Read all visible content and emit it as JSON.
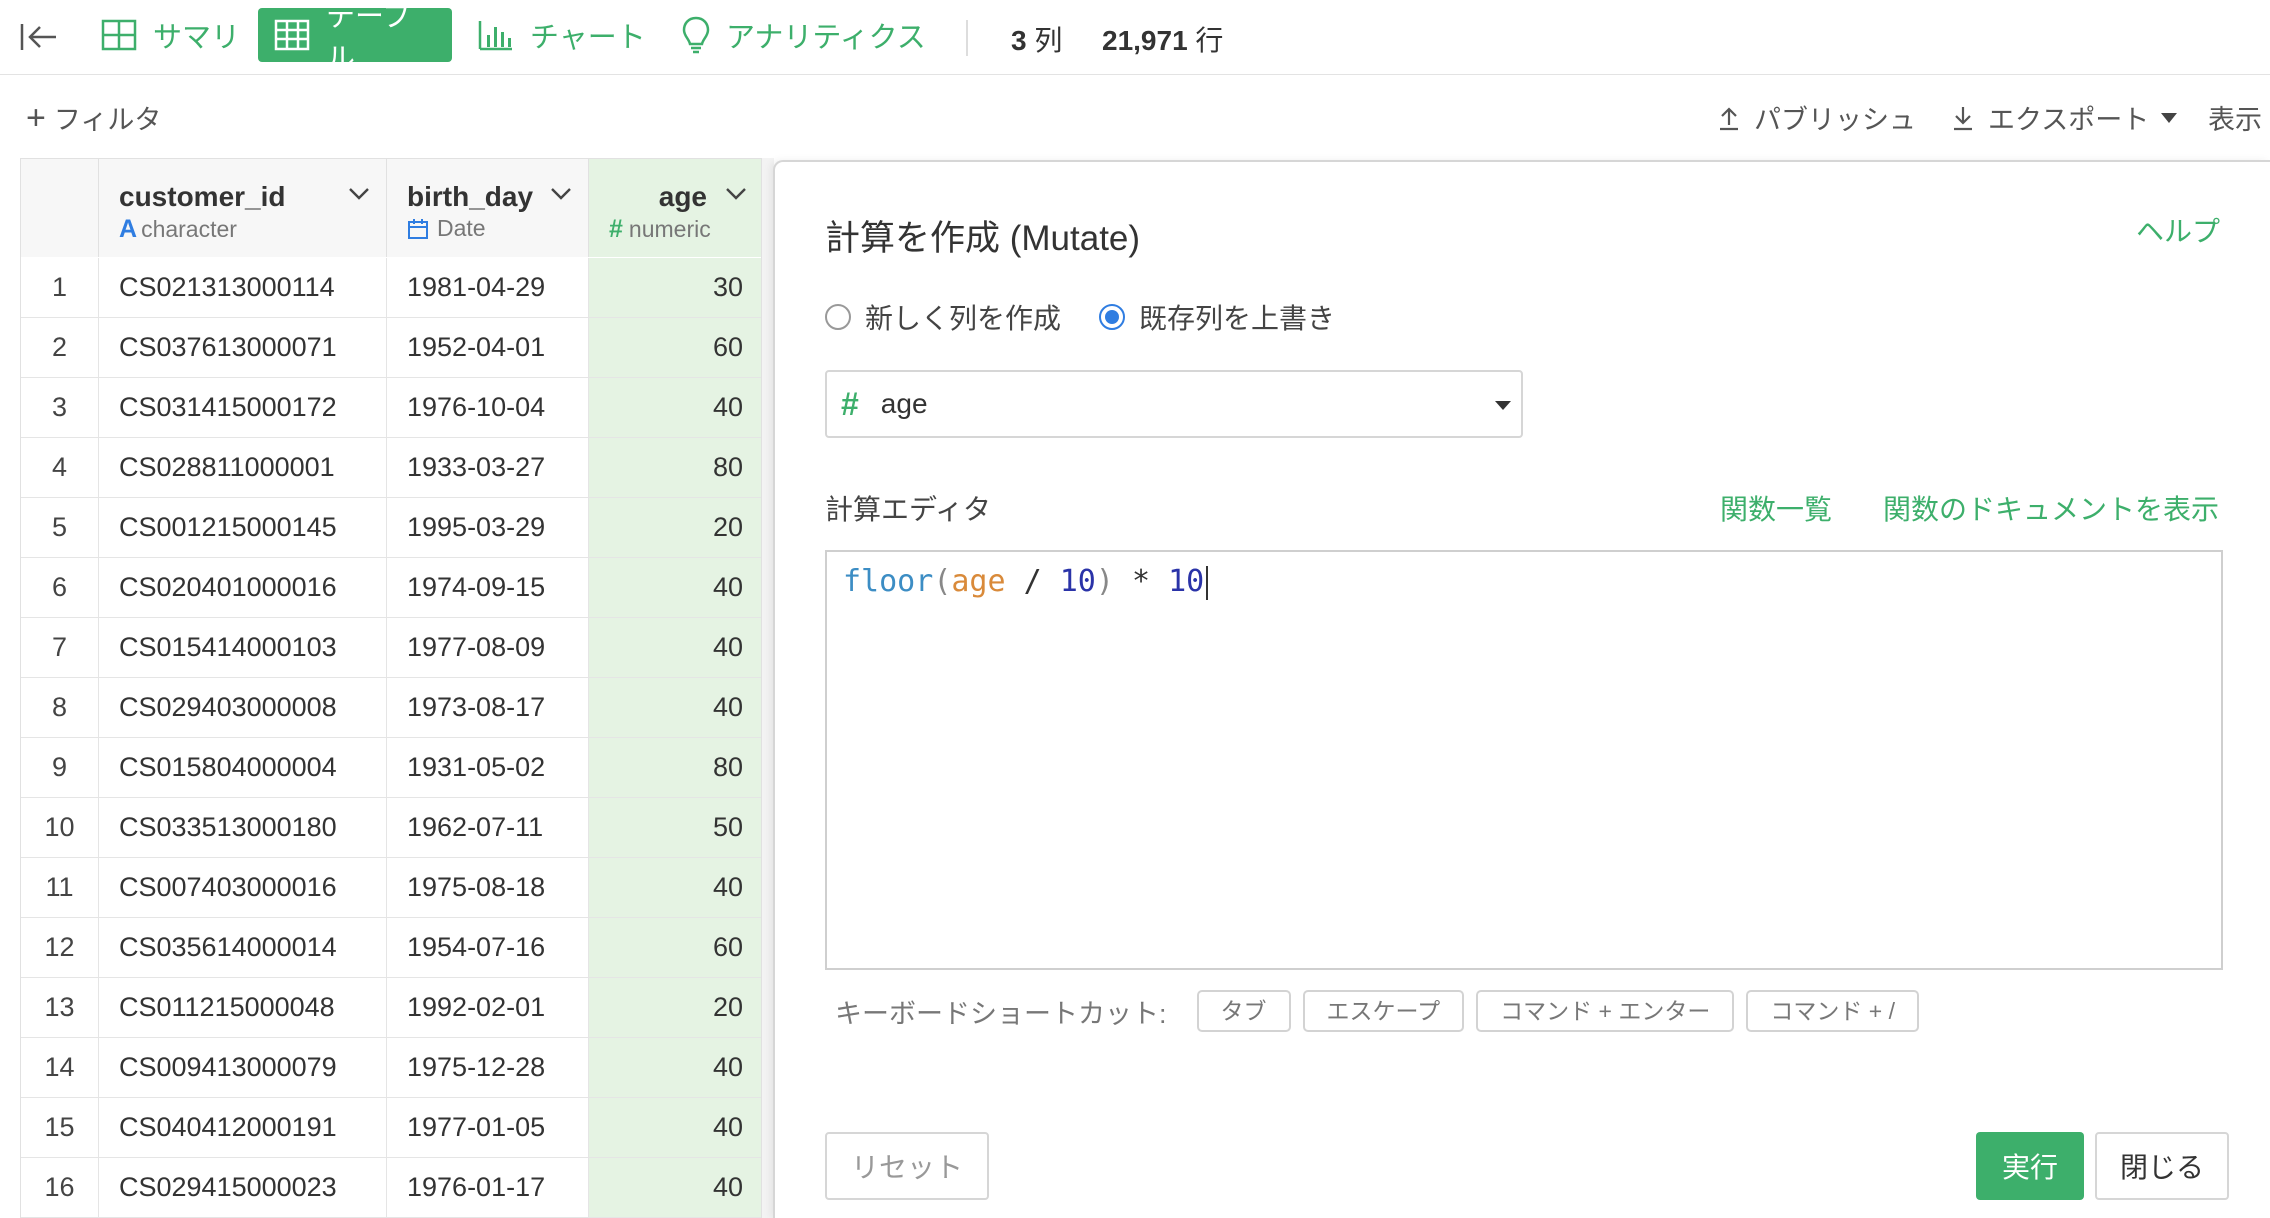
{
  "topbar": {
    "tabs": [
      {
        "label": "サマリ",
        "icon": "grid-icon"
      },
      {
        "label": "テーブル",
        "icon": "table-icon",
        "active": true
      },
      {
        "label": "チャート",
        "icon": "bar-chart-icon"
      },
      {
        "label": "アナリティクス",
        "icon": "lightbulb-icon"
      }
    ],
    "cols_count": "3",
    "cols_unit": "列",
    "rows_count": "21,971",
    "rows_unit": "行"
  },
  "toolbar": {
    "filter_label": "フィルタ",
    "publish_label": "パブリッシュ",
    "export_label": "エクスポート",
    "display_label": "表示"
  },
  "table": {
    "columns": [
      {
        "name": "customer_id",
        "type": "character",
        "type_icon": "A"
      },
      {
        "name": "birth_day",
        "type": "Date",
        "type_icon": "calendar-icon"
      },
      {
        "name": "age",
        "type": "numeric",
        "type_icon": "#"
      }
    ],
    "rows": [
      {
        "idx": "1",
        "customer_id": "CS021313000114",
        "birth_day": "1981-04-29",
        "age": "30"
      },
      {
        "idx": "2",
        "customer_id": "CS037613000071",
        "birth_day": "1952-04-01",
        "age": "60"
      },
      {
        "idx": "3",
        "customer_id": "CS031415000172",
        "birth_day": "1976-10-04",
        "age": "40"
      },
      {
        "idx": "4",
        "customer_id": "CS028811000001",
        "birth_day": "1933-03-27",
        "age": "80"
      },
      {
        "idx": "5",
        "customer_id": "CS001215000145",
        "birth_day": "1995-03-29",
        "age": "20"
      },
      {
        "idx": "6",
        "customer_id": "CS020401000016",
        "birth_day": "1974-09-15",
        "age": "40"
      },
      {
        "idx": "7",
        "customer_id": "CS015414000103",
        "birth_day": "1977-08-09",
        "age": "40"
      },
      {
        "idx": "8",
        "customer_id": "CS029403000008",
        "birth_day": "1973-08-17",
        "age": "40"
      },
      {
        "idx": "9",
        "customer_id": "CS015804000004",
        "birth_day": "1931-05-02",
        "age": "80"
      },
      {
        "idx": "10",
        "customer_id": "CS033513000180",
        "birth_day": "1962-07-11",
        "age": "50"
      },
      {
        "idx": "11",
        "customer_id": "CS007403000016",
        "birth_day": "1975-08-18",
        "age": "40"
      },
      {
        "idx": "12",
        "customer_id": "CS035614000014",
        "birth_day": "1954-07-16",
        "age": "60"
      },
      {
        "idx": "13",
        "customer_id": "CS011215000048",
        "birth_day": "1992-02-01",
        "age": "20"
      },
      {
        "idx": "14",
        "customer_id": "CS009413000079",
        "birth_day": "1975-12-28",
        "age": "40"
      },
      {
        "idx": "15",
        "customer_id": "CS040412000191",
        "birth_day": "1977-01-05",
        "age": "40"
      },
      {
        "idx": "16",
        "customer_id": "CS029415000023",
        "birth_day": "1976-01-17",
        "age": "40"
      }
    ]
  },
  "mutate": {
    "title": "計算を作成 (Mutate)",
    "help": "ヘルプ",
    "radio_new": "新しく列を作成",
    "radio_overwrite": "既存列を上書き",
    "selected_column": "age",
    "editor_label": "計算エディタ",
    "fn_list": "関数一覧",
    "fn_doc": "関数のドキュメントを表示",
    "code": {
      "fn": "floor",
      "var": "age",
      "op1": "/",
      "num1": "10",
      "op2": "*",
      "num2": "10"
    },
    "shortcut_label": "キーボードショートカット:",
    "shortcuts": [
      "タブ",
      "エスケープ",
      "コマンド + エンター",
      "コマンド + /"
    ],
    "reset": "リセット",
    "run": "実行",
    "close": "閉じる"
  },
  "colors": {
    "accent": "#3daf6b",
    "age_column_bg": "#e5f3e3",
    "radio_checked": "#2f7de1"
  }
}
